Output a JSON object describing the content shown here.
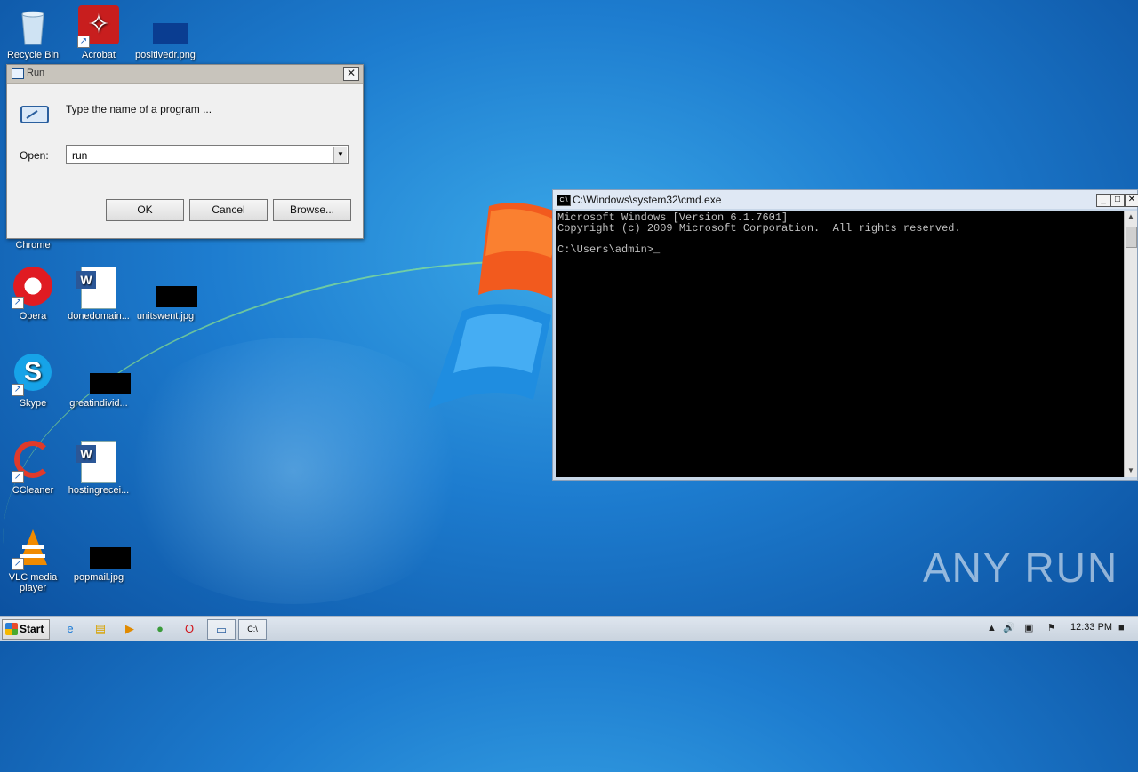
{
  "desktop": {
    "icons": [
      {
        "label": "Recycle Bin"
      },
      {
        "label": "Acrobat"
      },
      {
        "label": "positivedr.png"
      },
      {
        "label": "Chrome"
      },
      {
        "label": "Opera"
      },
      {
        "label": "donedomain..."
      },
      {
        "label": "unitswent.jpg"
      },
      {
        "label": "Skype"
      },
      {
        "label": "greatindivid..."
      },
      {
        "label": "CCleaner"
      },
      {
        "label": "hostingrecei..."
      },
      {
        "label": "VLC media player"
      },
      {
        "label": "popmail.jpg"
      }
    ]
  },
  "run_dialog": {
    "title": "Run",
    "description": "Type the name of a program ...",
    "open_label": "Open:",
    "open_value": "run",
    "ok_label": "OK",
    "cancel_label": "Cancel",
    "browse_label": "Browse..."
  },
  "cmd_window": {
    "title": "C:\\Windows\\system32\\cmd.exe",
    "lines": [
      "Microsoft Windows [Version 6.1.7601]",
      "Copyright (c) 2009 Microsoft Corporation.  All rights reserved.",
      "",
      "C:\\Users\\admin>_"
    ]
  },
  "watermark": "ANY RUN",
  "taskbar": {
    "start_label": "Start",
    "clock": "12:33 PM",
    "pinned": [
      "internet-explorer-icon",
      "explorer-icon",
      "media-player-icon",
      "chrome-icon",
      "opera-icon",
      "run-icon",
      "cmd-icon"
    ]
  }
}
